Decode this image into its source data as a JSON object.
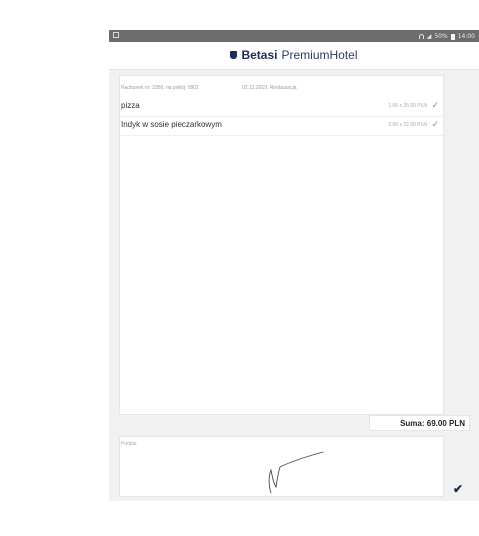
{
  "status_bar": {
    "battery": "50%",
    "time": "14:00"
  },
  "header": {
    "brand_bold": "Betasi",
    "brand_regular": "PremiumHotel"
  },
  "receipt": {
    "info": "Rachunek nr: 2350, na pokój: 0902",
    "date_place": "02.12.2019, Restauracja",
    "items": [
      {
        "name": "pizza",
        "qty": "1.00 x 25.00 PLN"
      },
      {
        "name": "Indyk w sosie pieczarkowym",
        "qty": "2.00 x 22.00 PLN"
      }
    ],
    "total": "Suma: 69.00 PLN"
  },
  "signature": {
    "label": "Podpis:"
  },
  "icons": {
    "check": "checkmark-icon",
    "confirm": "confirm-check-icon"
  },
  "colors": {
    "brand": "#1b2d54",
    "status_bar": "#6d6d6d"
  }
}
